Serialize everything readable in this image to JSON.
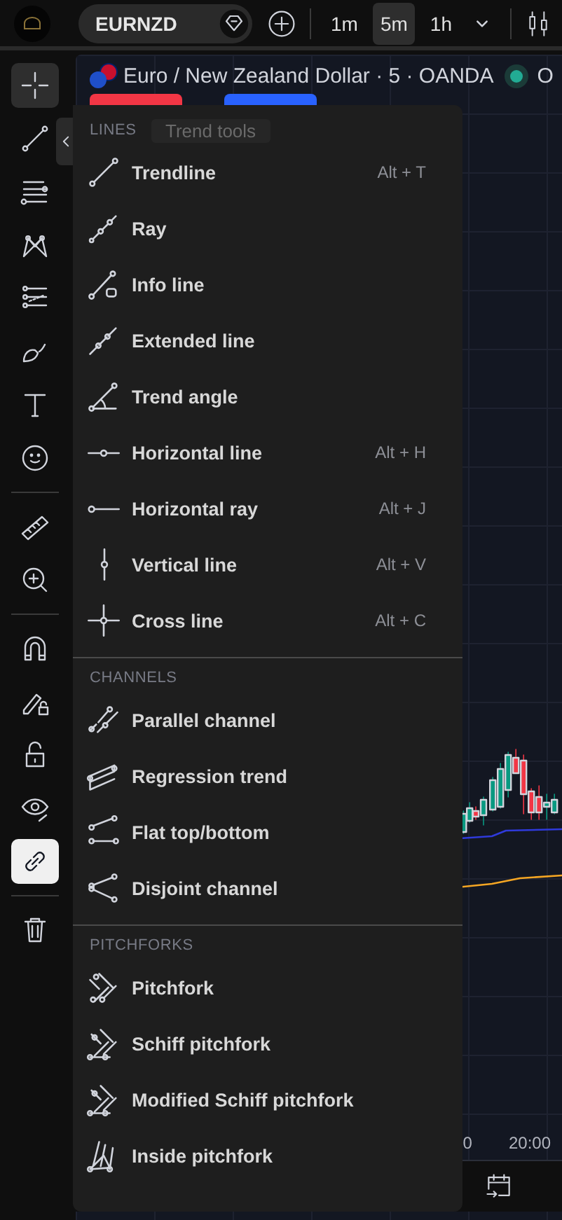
{
  "top_bar": {
    "symbol": "EURNZD",
    "intervals": [
      {
        "label": "1m",
        "selected": false
      },
      {
        "label": "5m",
        "selected": true
      },
      {
        "label": "1h",
        "selected": false
      }
    ]
  },
  "toolbar": {
    "tools": [
      {
        "kind": "crosshair",
        "selected": true
      },
      {
        "kind": "trendline",
        "selected": false
      },
      {
        "kind": "fib",
        "selected": false
      },
      {
        "kind": "pattern",
        "selected": false
      },
      {
        "kind": "forecast",
        "selected": false
      },
      {
        "kind": "brush",
        "selected": false
      },
      {
        "kind": "text",
        "selected": false
      },
      {
        "kind": "emoji",
        "selected": false
      },
      {
        "kind": "ruler",
        "selected": false
      },
      {
        "kind": "zoom",
        "selected": false
      },
      {
        "kind": "magnet",
        "selected": false
      },
      {
        "kind": "lock-drawing",
        "selected": false
      },
      {
        "kind": "lock",
        "selected": false
      },
      {
        "kind": "eye",
        "selected": false
      },
      {
        "kind": "link",
        "selected": true
      },
      {
        "kind": "trash",
        "selected": false
      }
    ]
  },
  "chart": {
    "title": "Euro / New Zealand Dollar · 5 · OANDA",
    "status": "O",
    "time_labels": [
      "0",
      "20:00"
    ]
  },
  "tooltip": "Trend tools",
  "menu": {
    "sections": [
      {
        "title": "LINES",
        "items": [
          {
            "kind": "trendline",
            "label": "Trendline",
            "shortcut": "Alt + T"
          },
          {
            "kind": "ray",
            "label": "Ray"
          },
          {
            "kind": "info",
            "label": "Info line"
          },
          {
            "kind": "extended",
            "label": "Extended line"
          },
          {
            "kind": "angle",
            "label": "Trend angle"
          },
          {
            "kind": "hline",
            "label": "Horizontal line",
            "shortcut": "Alt + H"
          },
          {
            "kind": "hray",
            "label": "Horizontal ray",
            "shortcut": "Alt + J"
          },
          {
            "kind": "vline",
            "label": "Vertical line",
            "shortcut": "Alt + V"
          },
          {
            "kind": "cross",
            "label": "Cross line",
            "shortcut": "Alt + C"
          }
        ]
      },
      {
        "title": "CHANNELS",
        "items": [
          {
            "kind": "parallel",
            "label": "Parallel channel"
          },
          {
            "kind": "regression",
            "label": "Regression trend"
          },
          {
            "kind": "flat",
            "label": "Flat top/bottom"
          },
          {
            "kind": "disjoint",
            "label": "Disjoint channel"
          }
        ]
      },
      {
        "title": "PITCHFORKS",
        "items": [
          {
            "kind": "pitchfork",
            "label": "Pitchfork"
          },
          {
            "kind": "schiff",
            "label": "Schiff pitchfork"
          },
          {
            "kind": "mschiff",
            "label": "Modified Schiff pitchfork"
          },
          {
            "kind": "inside",
            "label": "Inside pitchfork"
          }
        ]
      }
    ]
  }
}
